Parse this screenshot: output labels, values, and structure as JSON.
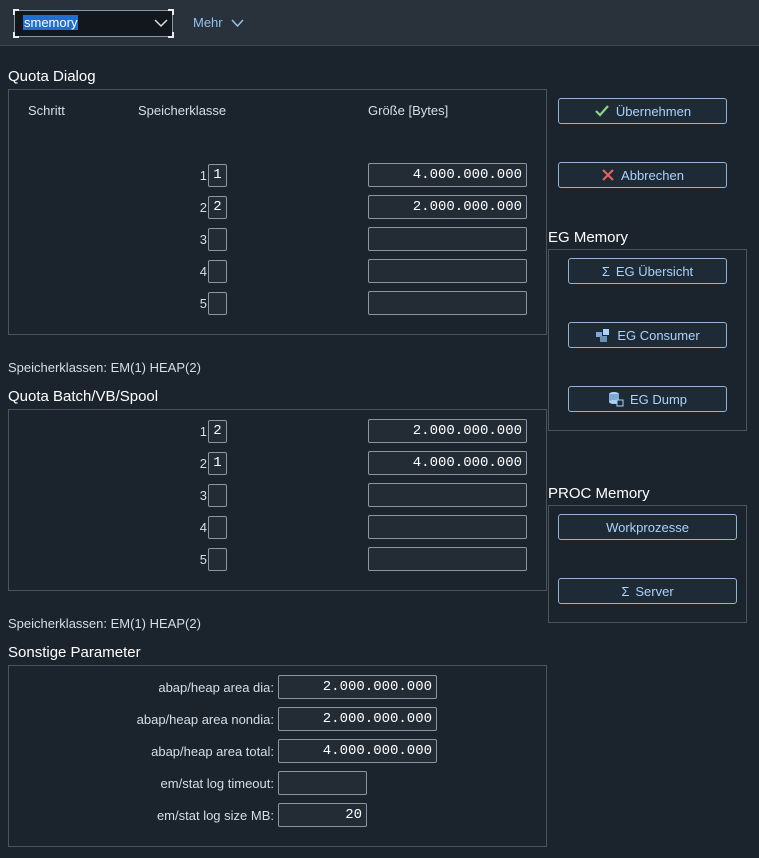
{
  "toolbar": {
    "command_value": "smemory",
    "more_label": "Mehr"
  },
  "quota_dialog": {
    "title": "Quota Dialog",
    "col_step": "Schritt",
    "col_class": "Speicherklasse",
    "col_size": "Größe [Bytes]",
    "rows": [
      {
        "step": "1",
        "class": "1",
        "size": "4.000.000.000"
      },
      {
        "step": "2",
        "class": "2",
        "size": "2.000.000.000"
      },
      {
        "step": "3",
        "class": "",
        "size": ""
      },
      {
        "step": "4",
        "class": "",
        "size": ""
      },
      {
        "step": "5",
        "class": "",
        "size": ""
      }
    ],
    "classes_note": "Speicherklassen: EM(1) HEAP(2)"
  },
  "quota_batch": {
    "title": "Quota Batch/VB/Spool",
    "rows": [
      {
        "step": "1",
        "class": "2",
        "size": "2.000.000.000"
      },
      {
        "step": "2",
        "class": "1",
        "size": "4.000.000.000"
      },
      {
        "step": "3",
        "class": "",
        "size": ""
      },
      {
        "step": "4",
        "class": "",
        "size": ""
      },
      {
        "step": "5",
        "class": "",
        "size": ""
      }
    ],
    "classes_note": "Speicherklassen: EM(1) HEAP(2)"
  },
  "other_params": {
    "title": "Sonstige Parameter",
    "rows": [
      {
        "label": "abap/heap area dia:",
        "value": "2.000.000.000"
      },
      {
        "label": "abap/heap area nondia:",
        "value": "2.000.000.000"
      },
      {
        "label": "abap/heap area total:",
        "value": "4.000.000.000"
      },
      {
        "label": "em/stat log timeout:",
        "value": ""
      },
      {
        "label": "em/stat log size MB:",
        "value": "20"
      }
    ]
  },
  "actions": {
    "accept_label": "Übernehmen",
    "cancel_label": "Abbrechen"
  },
  "eg_memory": {
    "title": "EG Memory",
    "overview_label": "EG Übersicht",
    "consumer_label": "EG Consumer",
    "dump_label": "EG Dump"
  },
  "proc_memory": {
    "title": "PROC Memory",
    "workprocesses_label": "Workprozesse",
    "server_label": "Server"
  },
  "colors": {
    "background": "#1b232d",
    "toolbar": "#29313a",
    "button_text": "#a9d3fb",
    "accept_check": "#8fd18a",
    "cancel_x": "#e0605c"
  }
}
